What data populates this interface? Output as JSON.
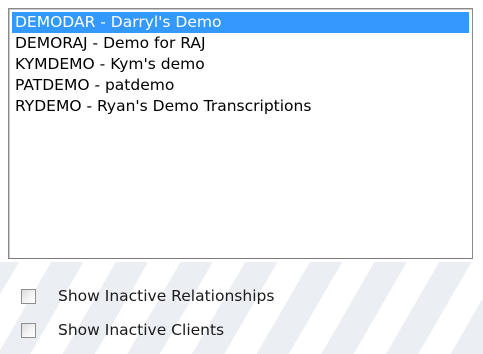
{
  "listbox": {
    "items": [
      {
        "label": "DEMODAR - Darryl's Demo",
        "selected": true
      },
      {
        "label": "DEMORAJ - Demo for RAJ",
        "selected": false
      },
      {
        "label": "KYMDEMO - Kym's demo",
        "selected": false
      },
      {
        "label": "PATDEMO - patdemo",
        "selected": false
      },
      {
        "label": "RYDEMO - Ryan's Demo Transcriptions",
        "selected": false
      }
    ],
    "selection_color": "#3399ff"
  },
  "options": {
    "show_inactive_relationships": {
      "label": "Show Inactive Relationships",
      "checked": false
    },
    "show_inactive_clients": {
      "label": "Show Inactive Clients",
      "checked": false
    }
  }
}
